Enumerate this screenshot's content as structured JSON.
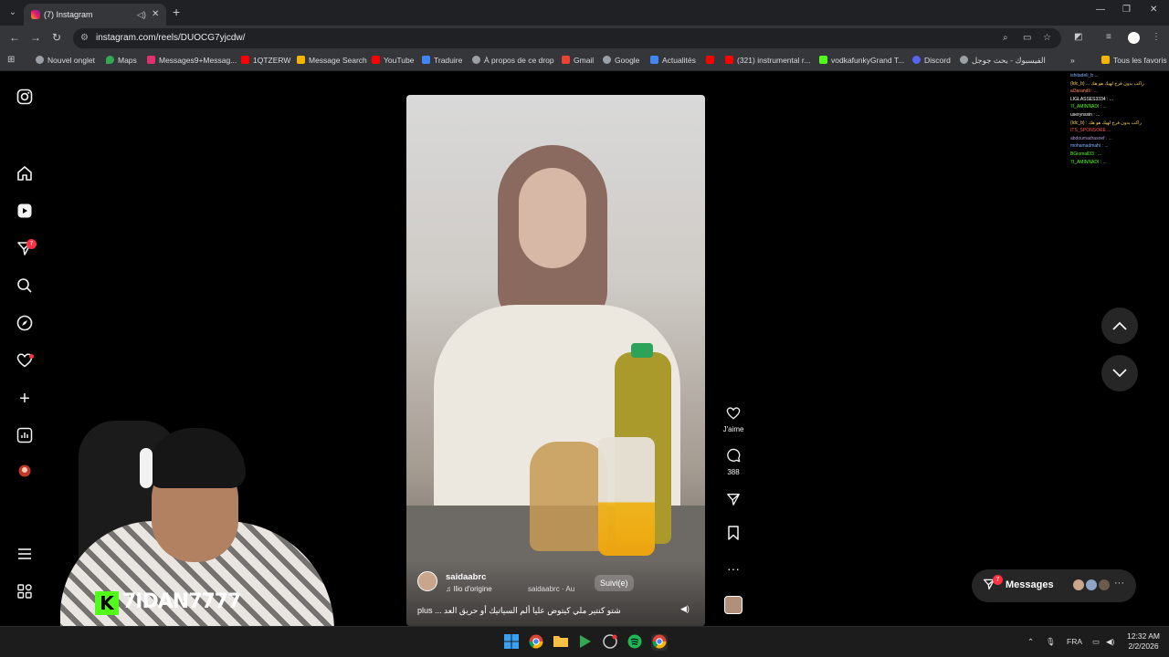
{
  "browser": {
    "tab_title": "(7) Instagram",
    "url": "instagram.com/reels/DUOCG7yjcdw/",
    "bookmarks": [
      {
        "label": "Nouvel onglet",
        "color": "#9aa0a6"
      },
      {
        "label": "Maps",
        "color": "#34a853"
      },
      {
        "label": "Messages9+Messag...",
        "color": "#e1306c"
      },
      {
        "label": "1QTZERW",
        "color": "#ff0000"
      },
      {
        "label": "Message Search",
        "color": "#f4b400"
      },
      {
        "label": "YouTube",
        "color": "#ff0000"
      },
      {
        "label": "Traduire",
        "color": "#4285f4"
      },
      {
        "label": "À propos de ce drop",
        "color": "#9aa0a6"
      },
      {
        "label": "Gmail",
        "color": "#ea4335"
      },
      {
        "label": "Google",
        "color": "#9aa0a6"
      },
      {
        "label": "Actualités",
        "color": "#4285f4"
      },
      {
        "label": "",
        "color": "#ff0000"
      },
      {
        "label": "(321) instrumental r...",
        "color": "#ff0000"
      },
      {
        "label": "vodkafunkyGrand T...",
        "color": "#53fc18"
      },
      {
        "label": "Discord",
        "color": "#5865f2"
      },
      {
        "label": "الفيسبوك - بحث جوجل",
        "color": "#9aa0a6"
      }
    ],
    "all_bookmarks": "Tous les favoris"
  },
  "sidebar": {
    "messages_badge": "7"
  },
  "reel": {
    "username": "saidaabrc",
    "audio": "Ilio d'origine",
    "audio_secondary": "saidaabrc · Au",
    "follow_label": "Suivi(e)",
    "caption": "plus ... شتو كنتير ملي كيتوض عليا ألم السياتيك أو حريق العد"
  },
  "actions": {
    "like_label": "J'aime",
    "comment_count": "388"
  },
  "messages": {
    "label": "Messages",
    "badge": "7"
  },
  "chat_lines": [
    {
      "text": "ishitadeli_b ...",
      "color": "#7fb3ff"
    },
    {
      "text": "(Idc_b) ... راكب بدون فرح لهيك هو هك",
      "color": "#ffd54f"
    },
    {
      "text": "al3arandli : ...",
      "color": "#ff8a65"
    },
    {
      "text": "LIGLASSES3334 : ...",
      "color": "#ffffff"
    },
    {
      "text": "7I_AMINNADI : ...",
      "color": "#53fc18"
    },
    {
      "text": "userynssin : ...",
      "color": "#ffffff"
    },
    {
      "text": "(Idc_b) : راكب بدون فرح لهيك هو هك",
      "color": "#ffd54f"
    },
    {
      "text": "ITS_SPONSORE ...",
      "color": "#ff5252"
    },
    {
      "text": "abdoumadrasoef : ...",
      "color": "#b39ddb"
    },
    {
      "text": "mohamadmahi : ...",
      "color": "#7fb3ff"
    },
    {
      "text": "BGiomall33 : ...",
      "color": "#53fc18"
    },
    {
      "text": "7I_AMINNADI : ...",
      "color": "#53fc18"
    }
  ],
  "streamer": {
    "name": "7IDAN7777"
  },
  "taskbar": {
    "language": "FRA",
    "time": "12:32 AM",
    "date": "2/2/2026"
  },
  "colors": {
    "accent_badge": "#ff3040",
    "kick_green": "#53fc18"
  }
}
